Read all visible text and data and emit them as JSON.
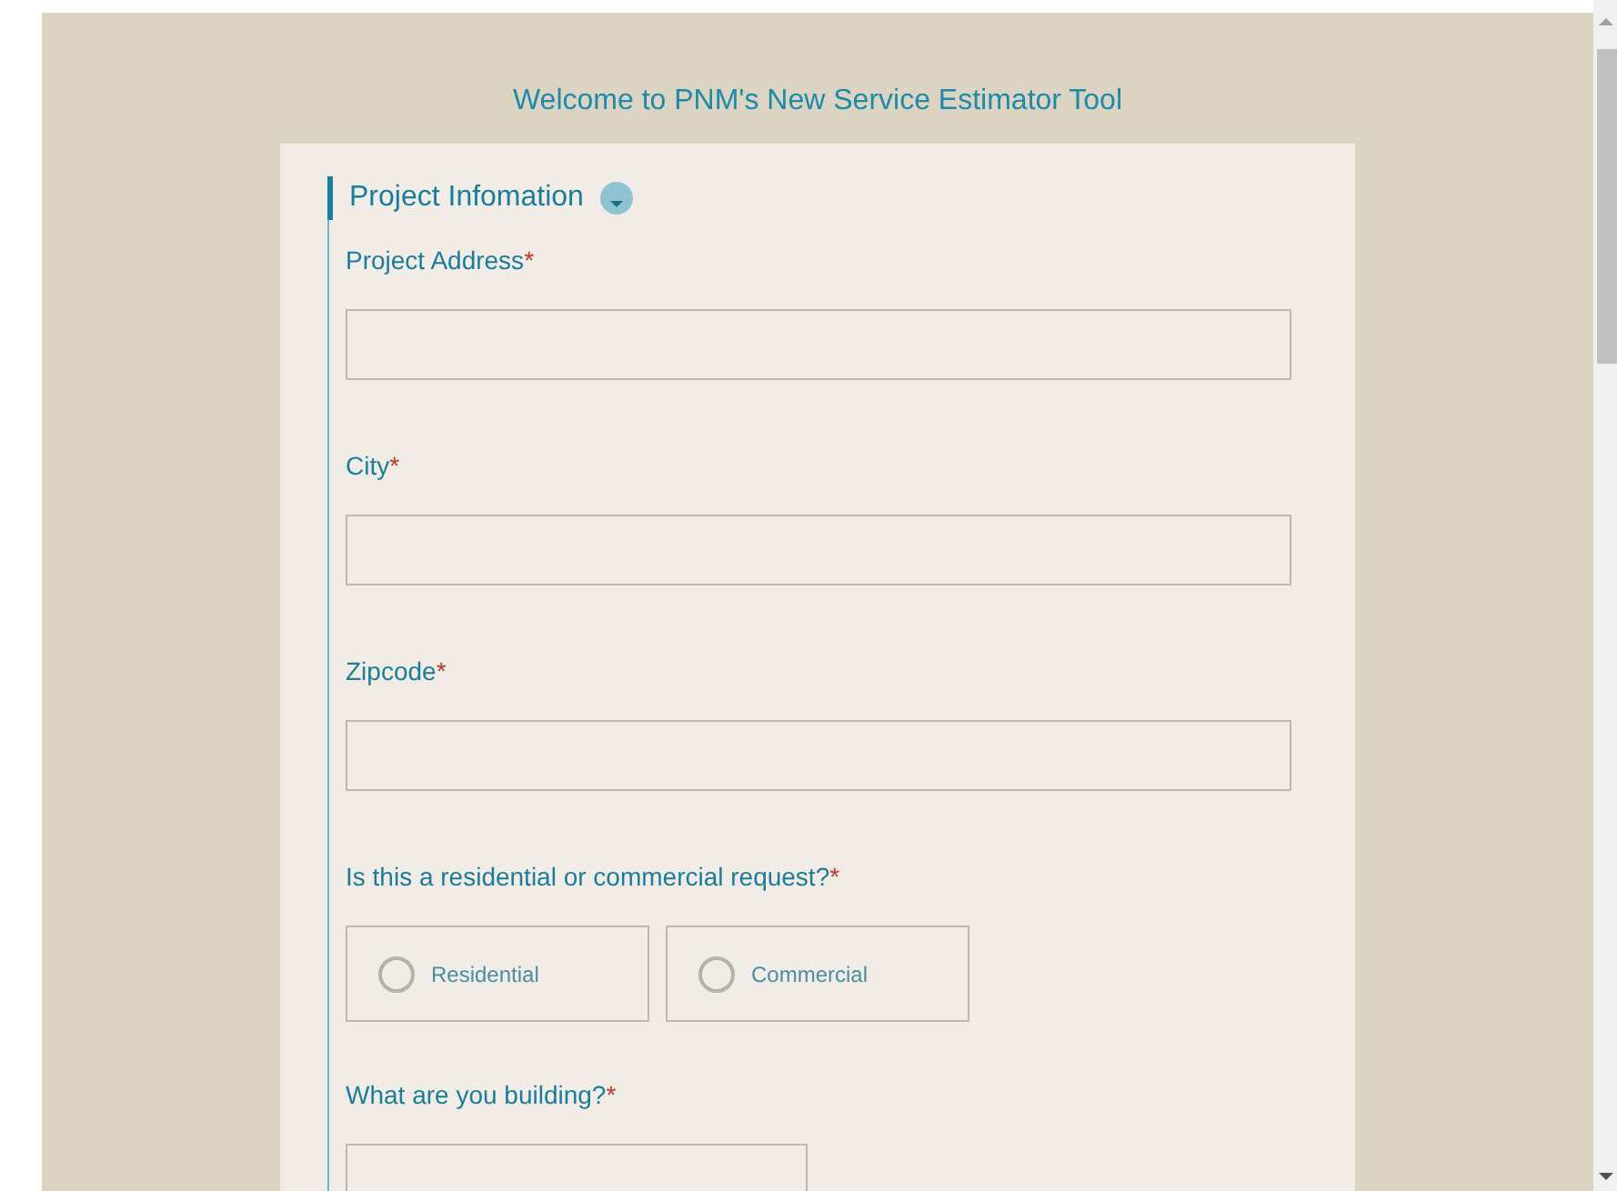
{
  "title": "Welcome to PNM's New Service Estimator Tool",
  "section": {
    "title": "Project Infomation",
    "expanded": true
  },
  "fields": [
    {
      "kind": "text",
      "label": "Project Address",
      "required_mark": "*"
    },
    {
      "kind": "text",
      "label": "City",
      "required_mark": "*"
    },
    {
      "kind": "text",
      "label": "Zipcode",
      "required_mark": "*"
    },
    {
      "kind": "radio",
      "label": "Is this a residential or commercial request?",
      "required_mark": "*",
      "options": [
        {
          "label": "Residential",
          "selected": false
        },
        {
          "label": "Commercial",
          "selected": false
        }
      ]
    },
    {
      "kind": "select",
      "label": "What are you building?",
      "required_mark": "*"
    }
  ]
}
